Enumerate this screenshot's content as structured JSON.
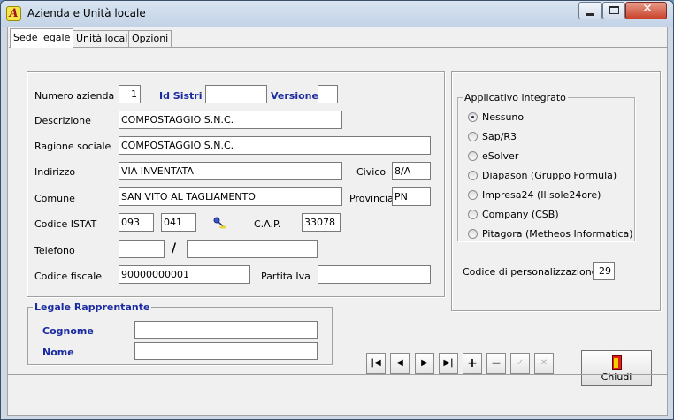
{
  "window": {
    "title": "Azienda e Unità locale",
    "app_icon_glyph": "A"
  },
  "tabs": [
    {
      "label": "Sede legale",
      "active": true
    },
    {
      "label": "Unità locali",
      "active": false
    },
    {
      "label": "Opzioni",
      "active": false
    }
  ],
  "form": {
    "numero_azienda": {
      "label": "Numero azienda",
      "value": "1"
    },
    "id_sistri": {
      "label": "Id Sistri",
      "value": ""
    },
    "versione": {
      "label": "Versione",
      "value": ""
    },
    "descrizione": {
      "label": "Descrizione",
      "value": "COMPOSTAGGIO S.N.C."
    },
    "ragione_sociale": {
      "label": "Ragione sociale",
      "value": "COMPOSTAGGIO  S.N.C."
    },
    "indirizzo": {
      "label": "Indirizzo",
      "value": "VIA INVENTATA"
    },
    "civico": {
      "label": "Civico",
      "value": "8/A"
    },
    "comune": {
      "label": "Comune",
      "value": "SAN VITO AL TAGLIAMENTO"
    },
    "provincia": {
      "label": "Provincia",
      "value": "PN"
    },
    "codice_istat": {
      "label": "Codice ISTAT",
      "value1": "093",
      "value2": "041"
    },
    "cap": {
      "label": "C.A.P.",
      "value": "33078"
    },
    "telefono": {
      "label": "Telefono",
      "value1": "",
      "value2": "",
      "separator": "/"
    },
    "codice_fiscale": {
      "label": "Codice fiscale",
      "value": "90000000001"
    },
    "partita_iva": {
      "label": "Partita Iva",
      "value": ""
    }
  },
  "applicativo": {
    "title": "Applicativo integrato",
    "options": [
      {
        "label": "Nessuno",
        "selected": true
      },
      {
        "label": "Sap/R3",
        "selected": false
      },
      {
        "label": "eSolver",
        "selected": false
      },
      {
        "label": "Diapason (Gruppo Formula)",
        "selected": false
      },
      {
        "label": "Impresa24 (Il sole24ore)",
        "selected": false
      },
      {
        "label": "Company (CSB)",
        "selected": false
      },
      {
        "label": "Pitagora (Metheos Informatica)",
        "selected": false
      }
    ],
    "codice_personalizzazione": {
      "label": "Codice di personalizzazione:",
      "value": "29"
    }
  },
  "legale": {
    "title": "Legale Rapprentante",
    "cognome": {
      "label": "Cognome",
      "value": ""
    },
    "nome": {
      "label": "Nome",
      "value": ""
    }
  },
  "nav": {
    "first": "|◀",
    "prev": "◀",
    "next": "▶",
    "last": "▶|",
    "add": "+",
    "delete": "−",
    "confirm": "✓",
    "cancel": "✕"
  },
  "chiudi_label": "Chiudi",
  "icons": {
    "lookup": "key-lookup-icon",
    "close_door": "exit-door-icon"
  }
}
